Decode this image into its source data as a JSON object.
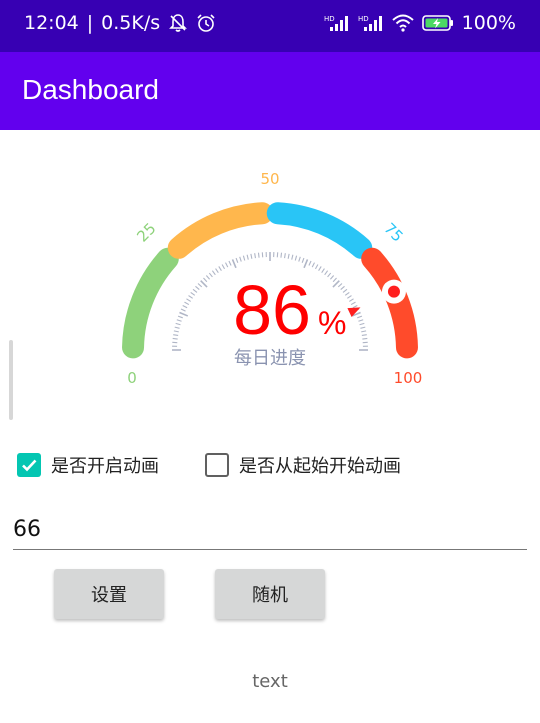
{
  "status_bar": {
    "time": "12:04",
    "speed": "0.5K/s",
    "battery": "100%",
    "icons": [
      "bell-off-icon",
      "alarm-icon",
      "hd-signal-icon",
      "hd-signal-icon",
      "wifi-icon",
      "battery-charging-icon"
    ]
  },
  "app_bar": {
    "title": "Dashboard"
  },
  "gauge": {
    "value": 86,
    "value_text": "86",
    "percent_sign": "%",
    "label": "每日进度",
    "ticks": [
      "0",
      "25",
      "50",
      "75",
      "100"
    ],
    "colors": {
      "green": "#8ed27b",
      "orange": "#ffb74d",
      "blue": "#29c5f6",
      "red": "#ff4b2b",
      "value_text": "#ff0000"
    }
  },
  "checkboxes": [
    {
      "label": "是否开启动画",
      "checked": true
    },
    {
      "label": "是否从起始开始动画",
      "checked": false
    }
  ],
  "input": {
    "value": "66"
  },
  "buttons": {
    "set": "设置",
    "random": "随机"
  },
  "footer": {
    "text": "text"
  }
}
